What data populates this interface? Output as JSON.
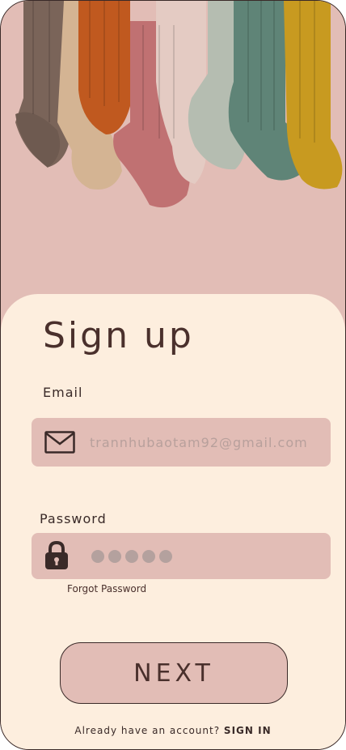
{
  "form": {
    "title": "Sign up",
    "email_label": "Email",
    "email_placeholder": "trannhubaotam92@gmail.com",
    "password_label": "Password",
    "password_masked_length": 5,
    "forgot_password": "Forgot Password",
    "next_button": "NEXT",
    "already_account": "Already have an account?",
    "sign_in_link": "SIGN IN"
  },
  "icons": {
    "email": "envelope-icon",
    "password": "lock-icon"
  },
  "colors": {
    "background": "#e2bdb6",
    "sheet": "#fdeede",
    "text": "#4a302c",
    "field": "#e2bdb6",
    "muted": "#b8a09c"
  }
}
